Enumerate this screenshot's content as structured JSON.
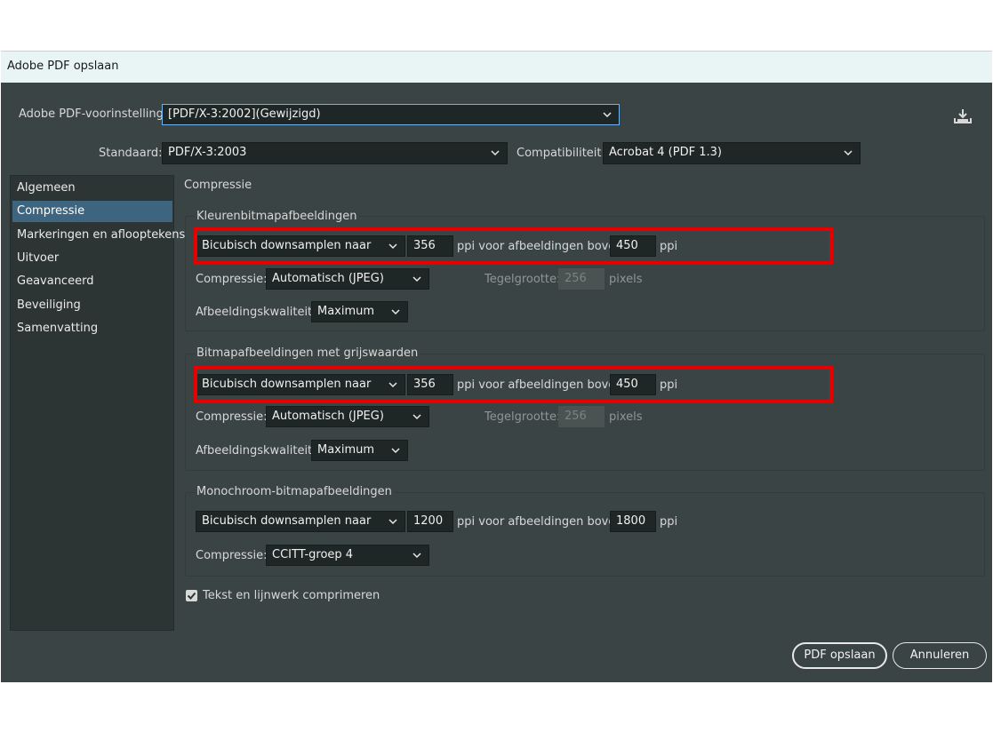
{
  "window": {
    "title": "Adobe PDF opslaan"
  },
  "preset": {
    "label": "Adobe PDF-voorinstelling:",
    "value": "[PDF/X-3:2002](Gewijzigd)"
  },
  "standard": {
    "label": "Standaard:",
    "value": "PDF/X-3:2003"
  },
  "compatibility": {
    "label": "Compatibiliteit:",
    "value": "Acrobat 4 (PDF 1.3)"
  },
  "sidebar": {
    "items": [
      {
        "label": "Algemeen"
      },
      {
        "label": "Compressie"
      },
      {
        "label": "Markeringen en aflooptekens"
      },
      {
        "label": "Uitvoer"
      },
      {
        "label": "Geavanceerd"
      },
      {
        "label": "Beveiliging"
      },
      {
        "label": "Samenvatting"
      }
    ]
  },
  "panel": {
    "title": "Compressie"
  },
  "color": {
    "title": "Kleurenbitmapafbeeldingen",
    "downsample": "Bicubisch downsamplen naar",
    "ppi": "356",
    "above_label": "ppi voor afbeeldingen boven",
    "above_value": "450",
    "ppi_unit": "ppi",
    "compression_label": "Compressie:",
    "compression_value": "Automatisch (JPEG)",
    "tile_label": "Tegelgrootte:",
    "tile_value": "256",
    "tile_unit": "pixels",
    "quality_label": "Afbeeldingskwaliteit:",
    "quality_value": "Maximum"
  },
  "gray": {
    "title": "Bitmapafbeeldingen met grijswaarden",
    "downsample": "Bicubisch downsamplen naar",
    "ppi": "356",
    "above_label": "ppi voor afbeeldingen boven",
    "above_value": "450",
    "ppi_unit": "ppi",
    "compression_label": "Compressie:",
    "compression_value": "Automatisch (JPEG)",
    "tile_label": "Tegelgrootte:",
    "tile_value": "256",
    "tile_unit": "pixels",
    "quality_label": "Afbeeldingskwaliteit:",
    "quality_value": "Maximum"
  },
  "mono": {
    "title": "Monochroom-bitmapafbeeldingen",
    "downsample": "Bicubisch downsamplen naar",
    "ppi": "1200",
    "above_label": "ppi voor afbeeldingen boven",
    "above_value": "1800",
    "ppi_unit": "ppi",
    "compression_label": "Compressie:",
    "compression_value": "CCITT-groep 4"
  },
  "text_compress": {
    "label": "Tekst en lijnwerk comprimeren",
    "checked": true
  },
  "buttons": {
    "save": "PDF opslaan",
    "cancel": "Annuleren"
  },
  "icons": {
    "save_preset": "save-preset-icon",
    "dropdown": "chevron-down-icon",
    "check": "checkmark-icon"
  },
  "colors": {
    "dialog_bg": "#3b4444",
    "selected": "#3d6580",
    "highlight": "#e60000",
    "focus": "#6fb2ee"
  }
}
